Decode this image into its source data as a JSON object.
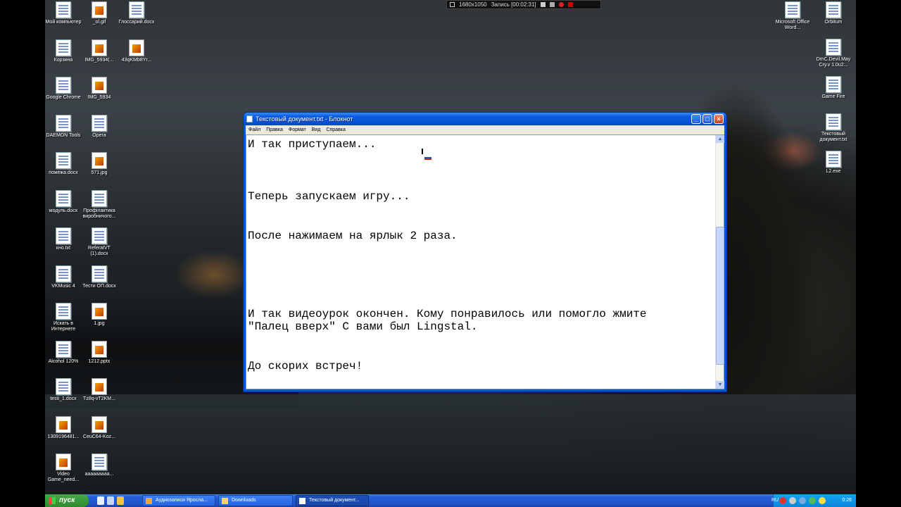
{
  "recorder": {
    "resolution": "1680x1050",
    "status": "Запись [00:02:31]"
  },
  "desktop_icons_left": [
    {
      "label": "Мой компьютер",
      "icon": "computer-icon"
    },
    {
      "label": "Корзина",
      "icon": "recycle-bin-icon"
    },
    {
      "label": "Google Chrome",
      "icon": "chrome-icon"
    },
    {
      "label": "DAEMON Tools",
      "icon": "daemon-tools-icon"
    },
    {
      "label": "пожежа.docx",
      "icon": "word-doc-icon"
    },
    {
      "label": "модуль.docx",
      "icon": "word-doc-icon"
    },
    {
      "label": "кно.txt",
      "icon": "text-file-icon"
    },
    {
      "label": "VKMusic 4",
      "icon": "vkmusic-icon"
    },
    {
      "label": "Искать в Интернете",
      "icon": "search-web-icon"
    },
    {
      "label": "Alcohol 120%",
      "icon": "alcohol-icon"
    },
    {
      "label": "testi_1.docx",
      "icon": "word-doc-icon"
    },
    {
      "label": "1309196481...",
      "icon": "jpg-icon"
    },
    {
      "label": "Video Game_need...",
      "icon": "jpg-icon"
    }
  ],
  "desktop_icons_col2": [
    {
      "label": "_ol.gif",
      "icon": "gif-icon"
    },
    {
      "label": "IMG_5934(...",
      "icon": "jpg-icon"
    },
    {
      "label": "IMG_5934",
      "icon": "jpg-icon"
    },
    {
      "label": "Opera",
      "icon": "opera-icon"
    },
    {
      "label": "571.jpg",
      "icon": "jpg-icon"
    },
    {
      "label": "Профілактика виробничого...",
      "icon": "word-doc-icon"
    },
    {
      "label": "ReferatVT (1).docx",
      "icon": "word-doc-icon"
    },
    {
      "label": "Тести ОП.docx",
      "icon": "word-doc-icon"
    },
    {
      "label": "1.jpg",
      "icon": "jpg-icon"
    },
    {
      "label": "1212.pptx",
      "icon": "pptx-icon"
    },
    {
      "label": "Tz8q-vT2KM...",
      "icon": "jpg-icon"
    },
    {
      "label": "CeuC64-Koz...",
      "icon": "jpg-icon"
    },
    {
      "label": "ааааааааа...",
      "icon": "text-file-icon"
    }
  ],
  "desktop_icons_col3": [
    {
      "label": "Глоссарий.docx",
      "icon": "word-doc-icon"
    },
    {
      "label": "43qKMb8Yr...",
      "icon": "jpg-icon"
    }
  ],
  "desktop_icons_right": [
    {
      "label": "Microsoft Office Word...",
      "icon": "word-app-icon"
    },
    {
      "label": "Orbitum",
      "icon": "orbitum-icon"
    },
    {
      "label": "DmC.Devil.May Cry.v 1.0u2...",
      "icon": "dmc-icon"
    },
    {
      "label": "Game Fire",
      "icon": "game-fire-icon"
    },
    {
      "label": "Текстовый документ.txt",
      "icon": "text-file-icon"
    },
    {
      "label": "L2.exe",
      "icon": "l2-icon"
    }
  ],
  "notepad": {
    "title": "Текстовый документ.txt - Блокнот",
    "menu": [
      "Файл",
      "Правка",
      "Формат",
      "Вид",
      "Справка"
    ],
    "lines": [
      "И так приступаем...",
      "",
      "",
      "",
      "Теперь запускаем игру...",
      "",
      "",
      "После нажимаем на ярлык 2 раза.",
      "",
      "",
      "",
      "",
      "",
      "И так видеоурок окончен. Кому понравилось или помогло жмите",
      "\"Палец вверх\" С вами был Lingstal.",
      "",
      "",
      "До скорих встреч!"
    ]
  },
  "taskbar": {
    "start_label": "пуск",
    "items": [
      {
        "label": "Аудиозаписи Яросла...",
        "active": false
      },
      {
        "label": "Downloads",
        "active": false
      },
      {
        "label": "Текстовый документ...",
        "active": true
      }
    ],
    "lang": "RU",
    "clock": "0:26"
  },
  "colors": {
    "xp_blue": "#0054e3",
    "start_green": "#3c9a3c"
  }
}
